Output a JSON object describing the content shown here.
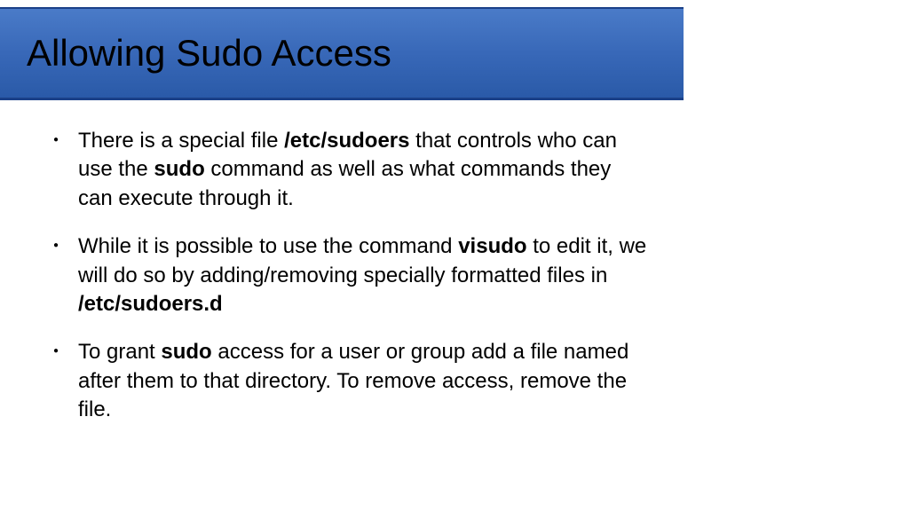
{
  "slide": {
    "title": "Allowing Sudo Access",
    "bullets": [
      {
        "segments": [
          {
            "text": "There is a special file ",
            "bold": false
          },
          {
            "text": "/etc/sudoers",
            "bold": true
          },
          {
            "text": " that controls who can use the ",
            "bold": false
          },
          {
            "text": "sudo",
            "bold": true
          },
          {
            "text": " command as well as what commands they can execute through it.",
            "bold": false
          }
        ]
      },
      {
        "segments": [
          {
            "text": "While it is possible to use the command ",
            "bold": false
          },
          {
            "text": "visudo",
            "bold": true
          },
          {
            "text": " to edit it, we will do so by adding/removing specially formatted files in ",
            "bold": false
          },
          {
            "text": "/etc/sudoers.d",
            "bold": true
          }
        ]
      },
      {
        "segments": [
          {
            "text": "To grant ",
            "bold": false
          },
          {
            "text": "sudo",
            "bold": true
          },
          {
            "text": " access for a user or group add a file named after them to that directory. To remove access, remove the file.",
            "bold": false
          }
        ]
      }
    ]
  }
}
